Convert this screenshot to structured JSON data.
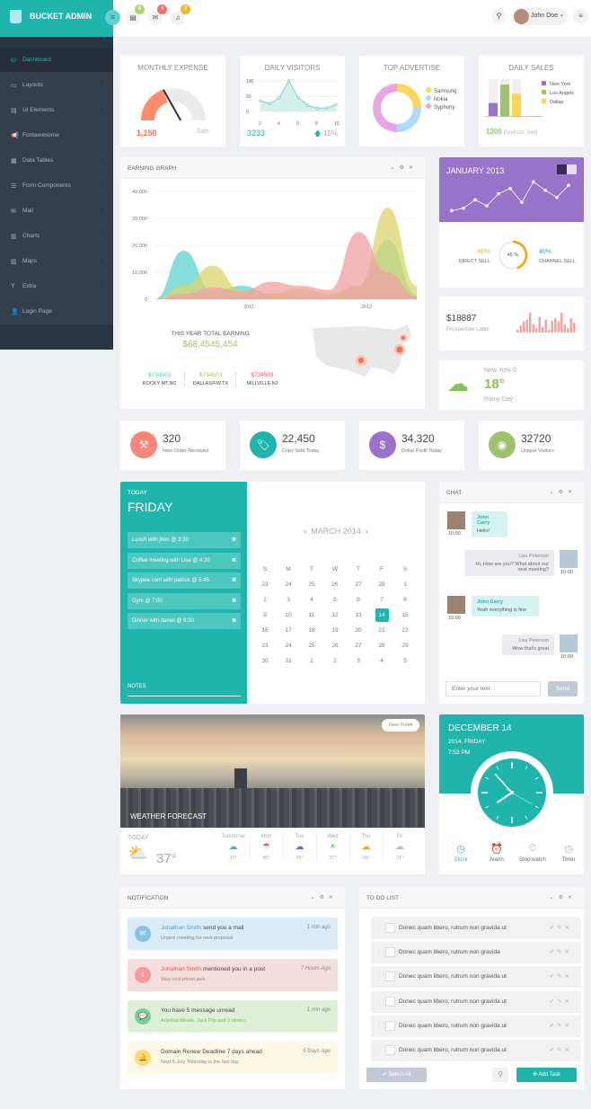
{
  "header": {
    "brand": "BUCKET ADMIN",
    "badges": {
      "tasks": "8",
      "mail": "4",
      "notifications": "3"
    },
    "badge_colors": {
      "tasks": "#a9d86e",
      "mail": "#ff6c60",
      "notifications": "#fcb322"
    },
    "user_name": "John Doe"
  },
  "sidebar": {
    "items": [
      {
        "label": "Dashboard",
        "icon": "dashboard-icon",
        "active": true
      },
      {
        "label": "Layouts",
        "icon": "laptop-icon"
      },
      {
        "label": "UI Elements",
        "icon": "book-icon"
      },
      {
        "label": "Fontawesome",
        "icon": "bullhorn-icon"
      },
      {
        "label": "Data Tables",
        "icon": "table-icon"
      },
      {
        "label": "Form Components",
        "icon": "form-icon"
      },
      {
        "label": "Mail",
        "icon": "envelope-icon"
      },
      {
        "label": "Charts",
        "icon": "chart-icon"
      },
      {
        "label": "Maps",
        "icon": "map-icon"
      },
      {
        "label": "Extra",
        "icon": "glass-icon"
      },
      {
        "label": "Login Page",
        "icon": "user-icon"
      }
    ]
  },
  "monthly_expense": {
    "title": "MONTHLY EXPENSE",
    "value": "1,150",
    "status": "Safe",
    "gauge_fraction": 0.4
  },
  "daily_visitors": {
    "title": "DAILY VISITORS",
    "value": "3233",
    "change": "15%",
    "chart_data": {
      "type": "line",
      "x": [
        2,
        3,
        4,
        5,
        6,
        7,
        8,
        9,
        10
      ],
      "values": [
        35,
        25,
        45,
        100,
        45,
        20,
        10,
        12,
        22
      ],
      "xticks": [
        "2",
        "4",
        "6",
        "8",
        "10"
      ],
      "yticks": [
        "100",
        "50",
        "0"
      ],
      "ylim": [
        0,
        100
      ]
    }
  },
  "top_advertise": {
    "title": "TOP ADVERTISE",
    "chart_data": {
      "type": "pie",
      "labels": [
        "Samsung",
        "Nokia",
        "Syphony"
      ],
      "values": [
        25,
        25,
        50
      ],
      "colors": [
        "#fdd752",
        "#aedaff",
        "#e7a6e0"
      ]
    }
  },
  "daily_sales": {
    "title": "DAILY SALES",
    "value": "1200",
    "label": "Products Sold",
    "chart_data": {
      "type": "bar",
      "categories": [
        "New York",
        "Los Angels",
        "Dallas"
      ],
      "values": [
        35,
        85,
        60
      ],
      "colors": [
        "#9972c9",
        "#9fc26e",
        "#fdd752"
      ],
      "ylim": [
        0,
        100
      ]
    }
  },
  "earning_graph": {
    "title": "EARNING GRAPH",
    "chart_data": {
      "type": "area",
      "yticks": [
        "40,000",
        "30,000",
        "20,000",
        "10,000",
        "0"
      ],
      "ylim": [
        0,
        40000
      ],
      "xticks": [
        "2011",
        "2012"
      ],
      "series": [
        {
          "name": "teal",
          "color": "#5dd3cf",
          "values": [
            0,
            18000,
            3000,
            5000,
            2000,
            1500,
            1000,
            5000,
            22000,
            1500
          ]
        },
        {
          "name": "yellow",
          "color": "#dbd56c",
          "values": [
            0,
            5000,
            12500,
            3000,
            2000,
            4000,
            2000,
            5000,
            34000,
            5000
          ]
        },
        {
          "name": "pink",
          "color": "#f0a0a3",
          "values": [
            0,
            2000,
            4500,
            3000,
            6500,
            5000,
            3500,
            25000,
            10000,
            1000
          ]
        }
      ]
    },
    "total_label": "THIS YEAR TOTAL EARNING",
    "total_value": "$68,4545,454",
    "cities": [
      {
        "value": "$734503",
        "name": "ROCKY MT,NC",
        "color": "#4ec7be"
      },
      {
        "value": "$734503",
        "name": "DALLAS/FW,TX",
        "color": "#a9c25d"
      },
      {
        "value": "$734503",
        "name": "MILLVILLE,NJ",
        "color": "#e8575a"
      }
    ]
  },
  "january": {
    "title": "JANUARY 2013",
    "line": [
      10,
      14,
      28,
      18,
      38,
      47,
      24,
      58,
      44,
      32,
      52
    ],
    "direct_pct": "60%",
    "direct_label": "DIRECT SELL",
    "channel_pct": "40%",
    "channel_label": "CHANNEL SELL",
    "center": "45 %",
    "progress": 0.45
  },
  "prospective": {
    "value": "$18887",
    "label": "Prospective Label",
    "bars": [
      2,
      5,
      8,
      9,
      14,
      6,
      3,
      11,
      4,
      9,
      2,
      8,
      10,
      8,
      14,
      6,
      3,
      10,
      7
    ]
  },
  "weather_small": {
    "city": "New York",
    "temp": "18°",
    "desc": "Rainy Day"
  },
  "stats": [
    {
      "value": "320",
      "label": "New Order Received",
      "color": "#fc8675",
      "icon": "gavel-icon"
    },
    {
      "value": "22,450",
      "label": "Copy Sold Today",
      "color": "#1fb5ad",
      "icon": "tag-icon"
    },
    {
      "value": "34,320",
      "label": "Dollar Profit Today",
      "color": "#9972c9",
      "icon": "money-icon"
    },
    {
      "value": "32720",
      "label": "Unique Visitors",
      "color": "#9fc26e",
      "icon": "eye-icon"
    }
  ],
  "today": {
    "label": "TODAY",
    "day": "FRIDAY",
    "events": [
      "Lunch with jhon @ 3:30",
      "Coffee meeting with Lisa @ 4:30",
      "Skypee conf with patrick @ 5:45",
      "Gym @ 7:00",
      "Dinner with daniel @ 9:30"
    ],
    "notes": "NOTES"
  },
  "calendar": {
    "month": "MARCH 2014",
    "weekdays": [
      "S",
      "M",
      "T",
      "W",
      "T",
      "F",
      "S"
    ],
    "weeks": [
      [
        "23",
        "24",
        "25",
        "26",
        "27",
        "28",
        "1"
      ],
      [
        "2",
        "3",
        "4",
        "5",
        "6",
        "7",
        "8"
      ],
      [
        "9",
        "10",
        "11",
        "12",
        "13",
        "14",
        "15"
      ],
      [
        "16",
        "17",
        "18",
        "19",
        "20",
        "21",
        "22"
      ],
      [
        "23",
        "24",
        "25",
        "26",
        "27",
        "28",
        "29"
      ],
      [
        "30",
        "31",
        "1",
        "2",
        "3",
        "4",
        "5"
      ]
    ],
    "today": "14"
  },
  "chat": {
    "title": "CHAT",
    "messages": [
      {
        "side": "l",
        "name": "John Carry",
        "text": "Hello!",
        "time": "10:00"
      },
      {
        "side": "r",
        "name": "Lisa Peterson",
        "text": "Hi, How are you? What about our next meeting?",
        "time": "10:00"
      },
      {
        "side": "l",
        "name": "John Carry",
        "text": "Yeah everything is fine",
        "time": "10:00"
      },
      {
        "side": "r",
        "name": "Lisa Peterson",
        "text": "Wow that's great",
        "time": "10:00"
      }
    ],
    "placeholder": "Enter your text",
    "send": "Send"
  },
  "weather": {
    "city_select": "New York",
    "banner": "WEATHER FORECAST",
    "today_label": "TODAY",
    "today_temp": "37°",
    "days": [
      {
        "name": "Tomorrow",
        "temp": "32°",
        "color": "#5aa6e6",
        "icon": "☁"
      },
      {
        "name": "Mon",
        "temp": "40°",
        "color": "#f06060",
        "icon": "☂"
      },
      {
        "name": "Tue",
        "temp": "25°",
        "color": "#7b5ecf",
        "icon": "☁"
      },
      {
        "name": "Wed",
        "temp": "37°",
        "color": "#8ccf3a",
        "icon": "☀"
      },
      {
        "name": "Thu",
        "temp": "15°",
        "color": "#f5a623",
        "icon": "☁"
      },
      {
        "name": "Fri",
        "temp": "21°",
        "color": "#bbbbbb",
        "icon": "☁"
      }
    ]
  },
  "clock": {
    "date": "DECEMBER 14",
    "sub": "2014, FRIDAY",
    "time": "7:53 PM",
    "tabs": [
      "Clock",
      "Alarm",
      "Stop watch",
      "Timer"
    ]
  },
  "notifications": {
    "title": "NOTIFICATION",
    "items": [
      {
        "name": "Jonathan Smith",
        "text": " send you a mail",
        "sub": "Urgent meeting for next proposal",
        "time": "1 min ago",
        "bg": "#d9ecf7",
        "ic": "#85c3e6",
        "nc": "#4a9fd8",
        "icon": "✉"
      },
      {
        "name": "Jonathan Smith",
        "text": " mentioned you in a post",
        "sub": "Very cool photo jack",
        "time": "7 Hours Ago",
        "bg": "#f5dcdd",
        "ic": "#f49a9b",
        "nc": "#e8575a",
        "icon": "f"
      },
      {
        "name": "",
        "text": "You have 5 message unread",
        "sub": "Anjelina Mewlo, Jack Flip and 3 others",
        "time": "1 min ago",
        "bg": "#dff0d8",
        "ic": "#7ccc98",
        "nc": "#444",
        "icon": "💬"
      },
      {
        "name": "",
        "text": "Domain Renew Deadline 7 days ahead",
        "sub": "Next 5 July Thursday is the last day",
        "time": "5 Days Ago",
        "bg": "#fcf8e3",
        "ic": "#fbdb79",
        "nc": "#444",
        "icon": "🔔"
      }
    ]
  },
  "todo": {
    "title": "TO DO LIST",
    "items": [
      "Donec quam libero, rutrum non gravida ut",
      "Donec quam libero, rutrum non gravida",
      "Donec quam libero, rutrum non gravida ut",
      "Donec quam libero, rutrum non gravida ut",
      "Donec quam libero, rutrum non gravida ut",
      "Donec quam libero, rutrum non gravida ut"
    ],
    "select_all": "✔ Select All",
    "add_task": "✚ Add Task"
  }
}
